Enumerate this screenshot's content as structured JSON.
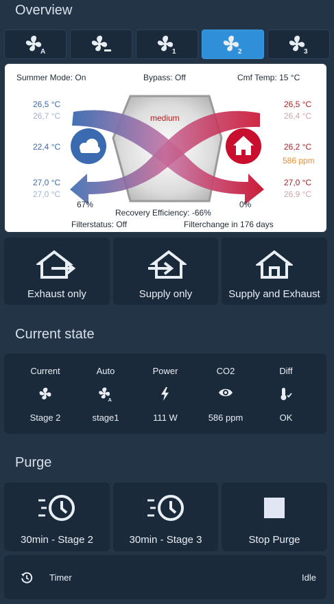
{
  "overview": {
    "title": "Overview",
    "stages": [
      {
        "icon": "fan-auto-icon",
        "badge": "A",
        "active": false
      },
      {
        "icon": "fan-off-icon",
        "badge": "–",
        "active": false
      },
      {
        "icon": "fan-stage-1-icon",
        "badge": "1",
        "active": false
      },
      {
        "icon": "fan-stage-2-icon",
        "badge": "2",
        "active": true
      },
      {
        "icon": "fan-stage-3-icon",
        "badge": "3",
        "active": false
      }
    ]
  },
  "diagram": {
    "summer_mode": "Summer Mode: On",
    "bypass": "Bypass: Off",
    "comfort_temp": "Cmf Temp: 15 °C",
    "level": "medium",
    "left_top_1": "26,5 °C",
    "left_top_2": "26,7 °C",
    "left_mid": "22,4 °C",
    "left_bot_1": "27,0 °C",
    "left_bot_2": "27,0 °C",
    "right_top_1": "26,5 °C",
    "right_top_2": "26,4 °C",
    "right_mid": "26,2 °C",
    "right_co2": "586 ppm",
    "right_bot_1": "27,0 °C",
    "right_bot_2": "26,9 °C",
    "left_percent": "67%",
    "right_percent": "0%",
    "recovery": "Recovery Efficiency: -66%",
    "filter_status": "Filterstatus: Off",
    "filter_change": "Filterchange in 176 days",
    "colors": {
      "blue": "#3a6ab0",
      "red": "#c8102e",
      "orange": "#f08c28"
    }
  },
  "modes": [
    {
      "label": "Exhaust only",
      "icon": "house-exhaust-icon"
    },
    {
      "label": "Supply only",
      "icon": "house-supply-icon"
    },
    {
      "label": "Supply and Exhaust",
      "icon": "house-supply-exhaust-icon"
    }
  ],
  "current_state": {
    "title": "Current state",
    "columns": [
      {
        "header": "Current",
        "icon": "fan-icon",
        "value": "Stage 2"
      },
      {
        "header": "Auto",
        "icon": "fan-auto-icon",
        "value": "stage1"
      },
      {
        "header": "Power",
        "icon": "lightning-icon",
        "value": "111 W"
      },
      {
        "header": "CO2",
        "icon": "eye-icon",
        "value": "586 ppm"
      },
      {
        "header": "Diff",
        "icon": "thermometer-check-icon",
        "value": "OK"
      }
    ]
  },
  "purge": {
    "title": "Purge",
    "buttons": [
      {
        "label": "30min - Stage 2",
        "icon": "fast-clock-icon"
      },
      {
        "label": "30min - Stage 3",
        "icon": "fast-clock-icon"
      },
      {
        "label": "Stop Purge",
        "icon": "stop-icon"
      }
    ],
    "timer_label": "Timer",
    "timer_status": "Idle"
  },
  "accent": "#2f8fd8"
}
